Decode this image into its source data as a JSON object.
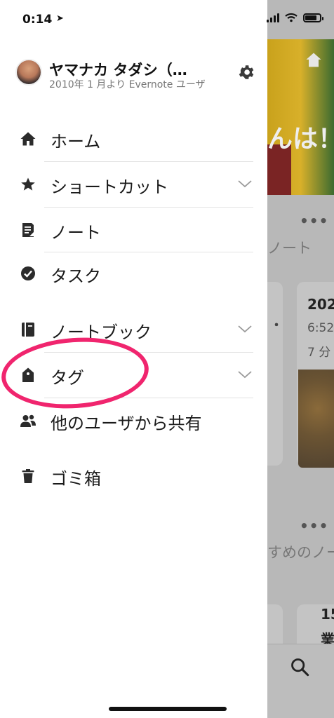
{
  "status_bar": {
    "time": "0:14",
    "location_arrow": "➤"
  },
  "background": {
    "greeting": "んは！",
    "section1": "ノート",
    "section2": "すめのノー",
    "card_title": "202",
    "card_time": "6:52",
    "card_ago": "7 分",
    "card_dot": "・",
    "card2_title": "15",
    "card2_sub": "業",
    "more": "•••"
  },
  "profile": {
    "name": "ヤマナカ タダシ（…",
    "since": "2010年 1 月より Evernote ユーザ"
  },
  "menu": [
    {
      "label": "ホーム",
      "icon": "home-icon"
    },
    {
      "label": "ショートカット",
      "icon": "star-icon"
    },
    {
      "label": "ノート",
      "icon": "note-icon"
    },
    {
      "label": "タスク",
      "icon": "task-check-icon"
    },
    {
      "label": "ノートブック",
      "icon": "notebook-icon"
    },
    {
      "label": "タグ",
      "icon": "tag-icon"
    },
    {
      "label": "他のユーザから共有",
      "icon": "shared-users-icon"
    },
    {
      "label": "ゴミ箱",
      "icon": "trash-icon"
    }
  ],
  "colors": {
    "annotation": "#f0256e"
  }
}
